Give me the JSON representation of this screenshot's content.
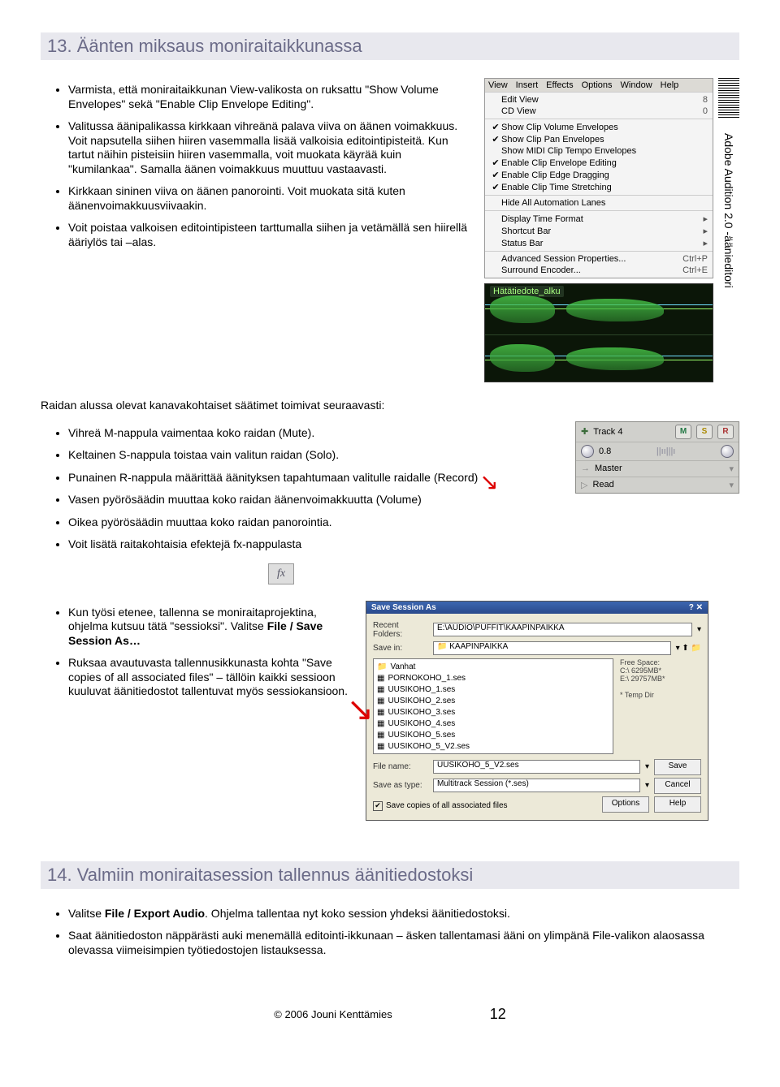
{
  "section13": {
    "title": "13. Äänten miksaus moniraitaikkunassa",
    "items_a": [
      "Varmista, että moniraitaikkunan View-valikosta on ruksattu \"Show Volume Envelopes\" sekä \"Enable Clip Envelope Editing\".",
      "Valitussa äänipalikassa kirkkaan vihreänä palava viiva on äänen voimakkuus. Voit napsutella siihen hiiren vasemmalla lisää valkoisia editointipisteitä. Kun tartut näihin pisteisiin hiiren vasemmalla, voit muokata käyrää kuin \"kumilankaa\". Samalla äänen voimakkuus muuttuu vastaavasti.",
      "Kirkkaan sininen viiva on äänen panorointi. Voit muokata sitä kuten äänenvoimakkuusviivaakin.",
      "Voit poistaa valkoisen editointipisteen tarttumalla siihen ja vetämällä sen hiirellä ääriylös tai –alas."
    ],
    "mid_para": "Raidan alussa olevat kanavakohtaiset säätimet toimivat seuraavasti:",
    "items_b": [
      "Vihreä M-nappula vaimentaa koko raidan (Mute).",
      "Keltainen S-nappula toistaa vain valitun raidan (Solo).",
      "Punainen R-nappula määrittää äänityksen tapahtumaan valitulle raidalle (Record)",
      "Vasen pyörösäädin muuttaa koko raidan äänenvoimakkuutta (Volume)",
      "Oikea pyörösäädin muuttaa koko raidan panorointia.",
      "Voit lisätä raitakohtaisia efektejä fx-nappulasta"
    ],
    "items_c_html": [
      "Kun työsi etenee, tallenna se moniraitaprojektina, ohjelma kutsuu tätä \"sessioksi\". Valitse <b>File / Save Session As…</b>",
      "Ruksaa avautuvasta tallennusikkunasta kohta \"Save copies of all associated files\" – tällöin kaikki sessioon kuuluvat äänitiedostot tallentuvat myös sessiokansioon."
    ]
  },
  "menu": {
    "bar": [
      "View",
      "Insert",
      "Effects",
      "Options",
      "Window",
      "Help"
    ],
    "items": [
      {
        "check": "",
        "label": "Edit View",
        "hint": "8"
      },
      {
        "check": "",
        "label": "CD View",
        "hint": "0"
      }
    ],
    "group2": [
      {
        "check": "✔",
        "label": "Show Clip Volume Envelopes"
      },
      {
        "check": "✔",
        "label": "Show Clip Pan Envelopes"
      },
      {
        "check": "",
        "label": "Show MIDI Clip Tempo Envelopes"
      },
      {
        "check": "✔",
        "label": "Enable Clip Envelope Editing"
      },
      {
        "check": "✔",
        "label": "Enable Clip Edge Dragging"
      },
      {
        "check": "✔",
        "label": "Enable Clip Time Stretching"
      }
    ],
    "group3": [
      {
        "check": "",
        "label": "Hide All Automation Lanes"
      }
    ],
    "group4": [
      {
        "check": "",
        "label": "Display Time Format",
        "hint": "▸"
      },
      {
        "check": "",
        "label": "Shortcut Bar",
        "hint": "▸"
      },
      {
        "check": "",
        "label": "Status Bar",
        "hint": "▸"
      }
    ],
    "group5": [
      {
        "check": "",
        "label": "Advanced Session Properties...",
        "hint": "Ctrl+P"
      },
      {
        "check": "",
        "label": "Surround Encoder...",
        "hint": "Ctrl+E"
      }
    ]
  },
  "waveform": {
    "title": "Hätätiedote_alku"
  },
  "sidebar_text": "Adobe Audition 2.0 -äänieditori",
  "track_panel": {
    "name": "Track 4",
    "btns": [
      "M",
      "S",
      "R"
    ],
    "vol_value": "0.8",
    "meter": "||ıı|||ı",
    "output": "Master",
    "mode": "Read",
    "fx_label": "fx"
  },
  "save_dialog": {
    "title": "Save Session As",
    "recent_label": "Recent Folders:",
    "recent_value": "E:\\AUDIO\\PUFFIT\\KAAPINPAIKKA",
    "savein_label": "Save in:",
    "savein_value": "KAAPINPAIKKA",
    "files": [
      "Vanhat",
      "PORNOKOHO_1.ses",
      "UUSIKOHO_1.ses",
      "UUSIKOHO_2.ses",
      "UUSIKOHO_3.ses",
      "UUSIKOHO_4.ses",
      "UUSIKOHO_5.ses",
      "UUSIKOHO_5_V2.ses"
    ],
    "free_label": "Free Space:",
    "free_lines": [
      "C:\\ 6295MB*",
      "E:\\ 29757MB*",
      "",
      "* Temp Dir"
    ],
    "filename_label": "File name:",
    "filename_value": "UUSIKOHO_5_V2.ses",
    "type_label": "Save as type:",
    "type_value": "Multitrack Session (*.ses)",
    "save_btn": "Save",
    "cancel_btn": "Cancel",
    "options_btn": "Options",
    "help_btn": "Help",
    "checkbox_label": "Save copies of all associated files"
  },
  "section14": {
    "title": "14. Valmiin moniraitasession tallennus äänitiedostoksi",
    "items_html": [
      "Valitse <b>File / Export Audio</b>. Ohjelma tallentaa nyt koko session yhdeksi äänitiedostoksi.",
      "Saat äänitiedoston näppärästi auki menemällä editointi-ikkunaan – äsken tallentamasi ääni on ylimpänä File-valikon alaosassa olevassa viimeisimpien työtiedostojen listauksessa."
    ]
  },
  "footer": {
    "copyright": "© 2006 Jouni Kenttämies",
    "page": "12"
  }
}
